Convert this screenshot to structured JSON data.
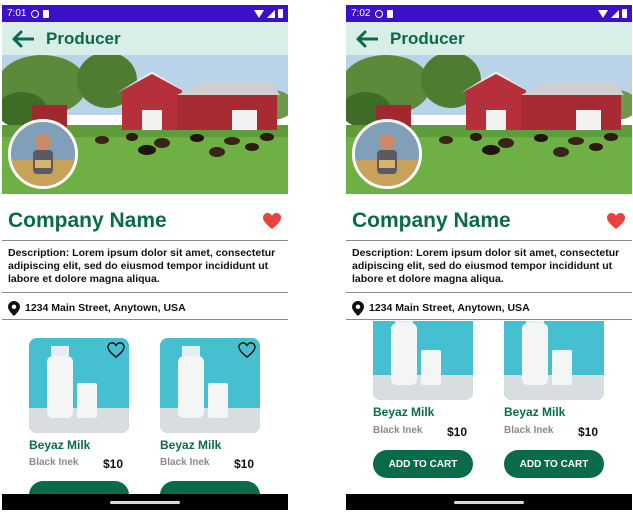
{
  "colors": {
    "status_bar": "#3a10c8",
    "accent": "#0a6b4a",
    "top_bar": "#d9ede9",
    "heart": "#e8423f"
  },
  "screens": [
    {
      "status": {
        "time": "7:01"
      },
      "top_bar": {
        "title": "Producer"
      },
      "company": {
        "name": "Company Name"
      },
      "description": "Description: Lorem ipsum dolor sit amet, consectetur adipiscing elit, sed do eiusmod tempor incididunt ut labore et dolore magna aliqua.",
      "address": "1234 Main Street, Anytown, USA",
      "products": [
        {
          "name": "Beyaz Milk",
          "brand": "Black Inek",
          "price": "$10",
          "button": ""
        },
        {
          "name": "Beyaz Milk",
          "brand": "Black Inek",
          "price": "$10",
          "button": ""
        }
      ]
    },
    {
      "status": {
        "time": "7:02"
      },
      "top_bar": {
        "title": "Producer"
      },
      "company": {
        "name": "Company Name"
      },
      "description": "Description: Lorem ipsum dolor sit amet, consectetur adipiscing elit, sed do eiusmod tempor incididunt ut labore et dolore magna aliqua.",
      "address": "1234 Main Street, Anytown, USA",
      "products": [
        {
          "name": "Beyaz Milk",
          "brand": "Black Inek",
          "price": "$10",
          "button": "ADD TO CART"
        },
        {
          "name": "Beyaz Milk",
          "brand": "Black Inek",
          "price": "$10",
          "button": "ADD TO CART"
        }
      ]
    }
  ]
}
